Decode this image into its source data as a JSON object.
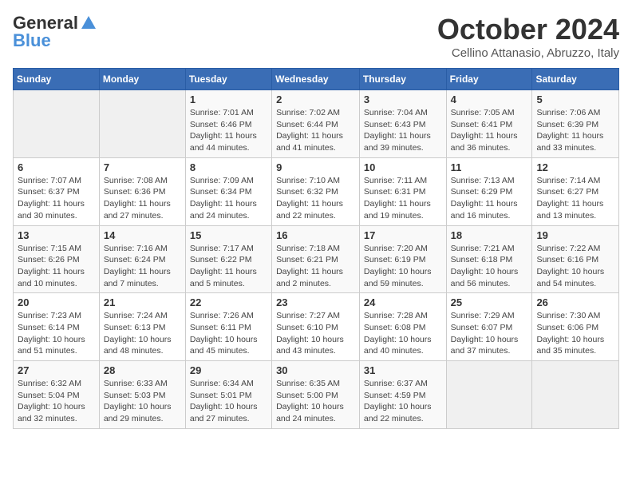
{
  "header": {
    "logo_general": "General",
    "logo_blue": "Blue",
    "month": "October 2024",
    "location": "Cellino Attanasio, Abruzzo, Italy"
  },
  "weekdays": [
    "Sunday",
    "Monday",
    "Tuesday",
    "Wednesday",
    "Thursday",
    "Friday",
    "Saturday"
  ],
  "weeks": [
    [
      {
        "day": "",
        "info": ""
      },
      {
        "day": "",
        "info": ""
      },
      {
        "day": "1",
        "info": "Sunrise: 7:01 AM\nSunset: 6:46 PM\nDaylight: 11 hours and 44 minutes."
      },
      {
        "day": "2",
        "info": "Sunrise: 7:02 AM\nSunset: 6:44 PM\nDaylight: 11 hours and 41 minutes."
      },
      {
        "day": "3",
        "info": "Sunrise: 7:04 AM\nSunset: 6:43 PM\nDaylight: 11 hours and 39 minutes."
      },
      {
        "day": "4",
        "info": "Sunrise: 7:05 AM\nSunset: 6:41 PM\nDaylight: 11 hours and 36 minutes."
      },
      {
        "day": "5",
        "info": "Sunrise: 7:06 AM\nSunset: 6:39 PM\nDaylight: 11 hours and 33 minutes."
      }
    ],
    [
      {
        "day": "6",
        "info": "Sunrise: 7:07 AM\nSunset: 6:37 PM\nDaylight: 11 hours and 30 minutes."
      },
      {
        "day": "7",
        "info": "Sunrise: 7:08 AM\nSunset: 6:36 PM\nDaylight: 11 hours and 27 minutes."
      },
      {
        "day": "8",
        "info": "Sunrise: 7:09 AM\nSunset: 6:34 PM\nDaylight: 11 hours and 24 minutes."
      },
      {
        "day": "9",
        "info": "Sunrise: 7:10 AM\nSunset: 6:32 PM\nDaylight: 11 hours and 22 minutes."
      },
      {
        "day": "10",
        "info": "Sunrise: 7:11 AM\nSunset: 6:31 PM\nDaylight: 11 hours and 19 minutes."
      },
      {
        "day": "11",
        "info": "Sunrise: 7:13 AM\nSunset: 6:29 PM\nDaylight: 11 hours and 16 minutes."
      },
      {
        "day": "12",
        "info": "Sunrise: 7:14 AM\nSunset: 6:27 PM\nDaylight: 11 hours and 13 minutes."
      }
    ],
    [
      {
        "day": "13",
        "info": "Sunrise: 7:15 AM\nSunset: 6:26 PM\nDaylight: 11 hours and 10 minutes."
      },
      {
        "day": "14",
        "info": "Sunrise: 7:16 AM\nSunset: 6:24 PM\nDaylight: 11 hours and 7 minutes."
      },
      {
        "day": "15",
        "info": "Sunrise: 7:17 AM\nSunset: 6:22 PM\nDaylight: 11 hours and 5 minutes."
      },
      {
        "day": "16",
        "info": "Sunrise: 7:18 AM\nSunset: 6:21 PM\nDaylight: 11 hours and 2 minutes."
      },
      {
        "day": "17",
        "info": "Sunrise: 7:20 AM\nSunset: 6:19 PM\nDaylight: 10 hours and 59 minutes."
      },
      {
        "day": "18",
        "info": "Sunrise: 7:21 AM\nSunset: 6:18 PM\nDaylight: 10 hours and 56 minutes."
      },
      {
        "day": "19",
        "info": "Sunrise: 7:22 AM\nSunset: 6:16 PM\nDaylight: 10 hours and 54 minutes."
      }
    ],
    [
      {
        "day": "20",
        "info": "Sunrise: 7:23 AM\nSunset: 6:14 PM\nDaylight: 10 hours and 51 minutes."
      },
      {
        "day": "21",
        "info": "Sunrise: 7:24 AM\nSunset: 6:13 PM\nDaylight: 10 hours and 48 minutes."
      },
      {
        "day": "22",
        "info": "Sunrise: 7:26 AM\nSunset: 6:11 PM\nDaylight: 10 hours and 45 minutes."
      },
      {
        "day": "23",
        "info": "Sunrise: 7:27 AM\nSunset: 6:10 PM\nDaylight: 10 hours and 43 minutes."
      },
      {
        "day": "24",
        "info": "Sunrise: 7:28 AM\nSunset: 6:08 PM\nDaylight: 10 hours and 40 minutes."
      },
      {
        "day": "25",
        "info": "Sunrise: 7:29 AM\nSunset: 6:07 PM\nDaylight: 10 hours and 37 minutes."
      },
      {
        "day": "26",
        "info": "Sunrise: 7:30 AM\nSunset: 6:06 PM\nDaylight: 10 hours and 35 minutes."
      }
    ],
    [
      {
        "day": "27",
        "info": "Sunrise: 6:32 AM\nSunset: 5:04 PM\nDaylight: 10 hours and 32 minutes."
      },
      {
        "day": "28",
        "info": "Sunrise: 6:33 AM\nSunset: 5:03 PM\nDaylight: 10 hours and 29 minutes."
      },
      {
        "day": "29",
        "info": "Sunrise: 6:34 AM\nSunset: 5:01 PM\nDaylight: 10 hours and 27 minutes."
      },
      {
        "day": "30",
        "info": "Sunrise: 6:35 AM\nSunset: 5:00 PM\nDaylight: 10 hours and 24 minutes."
      },
      {
        "day": "31",
        "info": "Sunrise: 6:37 AM\nSunset: 4:59 PM\nDaylight: 10 hours and 22 minutes."
      },
      {
        "day": "",
        "info": ""
      },
      {
        "day": "",
        "info": ""
      }
    ]
  ]
}
